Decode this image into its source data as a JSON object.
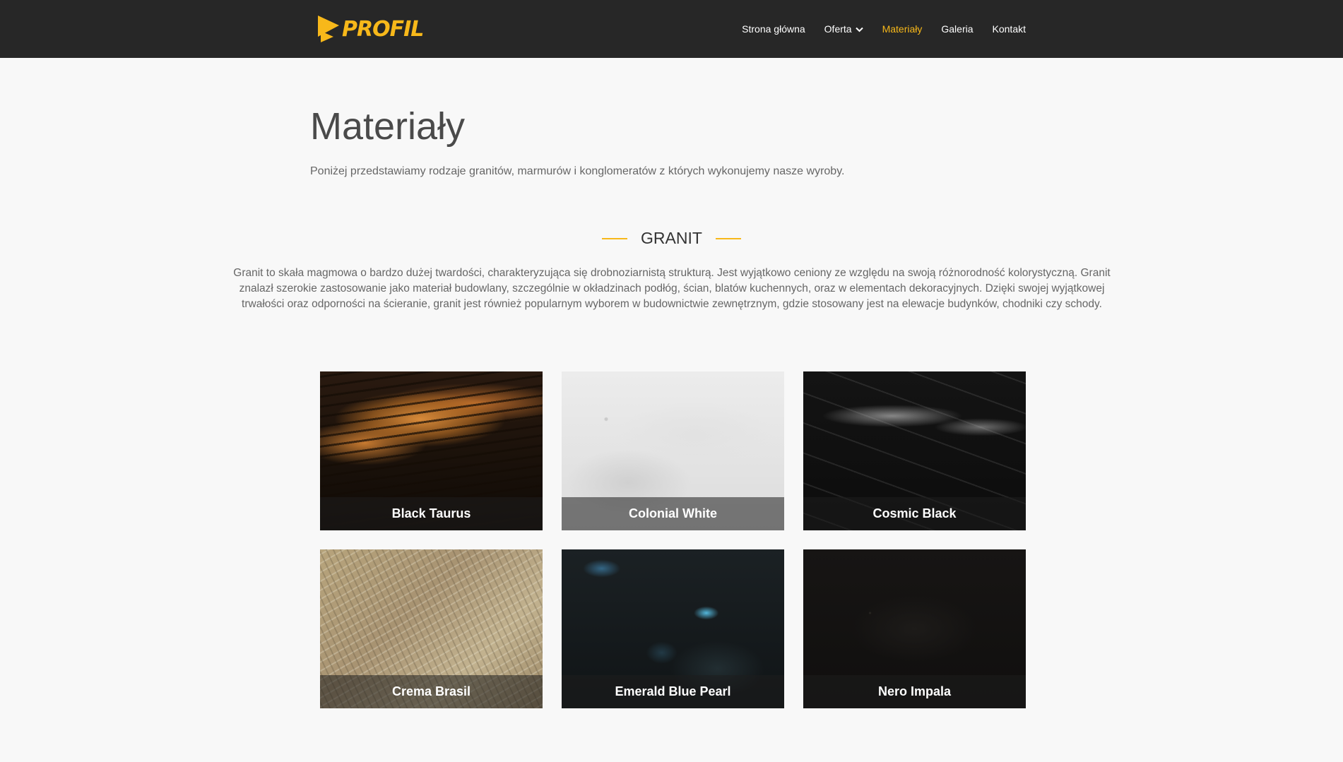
{
  "brand": {
    "name": "PROFIL",
    "color": "#f7b81a"
  },
  "nav": {
    "items": [
      {
        "label": "Strona główna",
        "active": false
      },
      {
        "label": "Oferta",
        "active": false,
        "has_dropdown": true
      },
      {
        "label": "Materiały",
        "active": true
      },
      {
        "label": "Galeria",
        "active": false
      },
      {
        "label": "Kontakt",
        "active": false
      }
    ]
  },
  "page": {
    "title": "Materiały",
    "intro": "Poniżej przedstawiamy rodzaje granitów, marmurów i konglomeratów z których wykonujemy nasze wyroby."
  },
  "section": {
    "heading": "GRANIT",
    "description": "Granit to skała magmowa o bardzo dużej twardości, charakteryzująca się drobnoziarnistą strukturą. Jest wyjątkowo ceniony ze względu na swoją różnorodność kolorystyczną. Granit znalazł szerokie zastosowanie jako materiał budowlany, szczególnie w okładzinach podłóg, ścian, blatów kuchennych, oraz w elementach dekoracyjnych. Dzięki swojej wyjątkowej trwałości oraz odporności na ścieranie, granit jest również popularnym wyborem w budownictwie zewnętrznym, gdzie stosowany jest na elewacje budynków, chodniki czy schody."
  },
  "materials": [
    {
      "name": "Black Taurus"
    },
    {
      "name": "Colonial White"
    },
    {
      "name": "Cosmic Black"
    },
    {
      "name": "Crema Brasil"
    },
    {
      "name": "Emerald Blue Pearl"
    },
    {
      "name": "Nero Impala"
    }
  ]
}
